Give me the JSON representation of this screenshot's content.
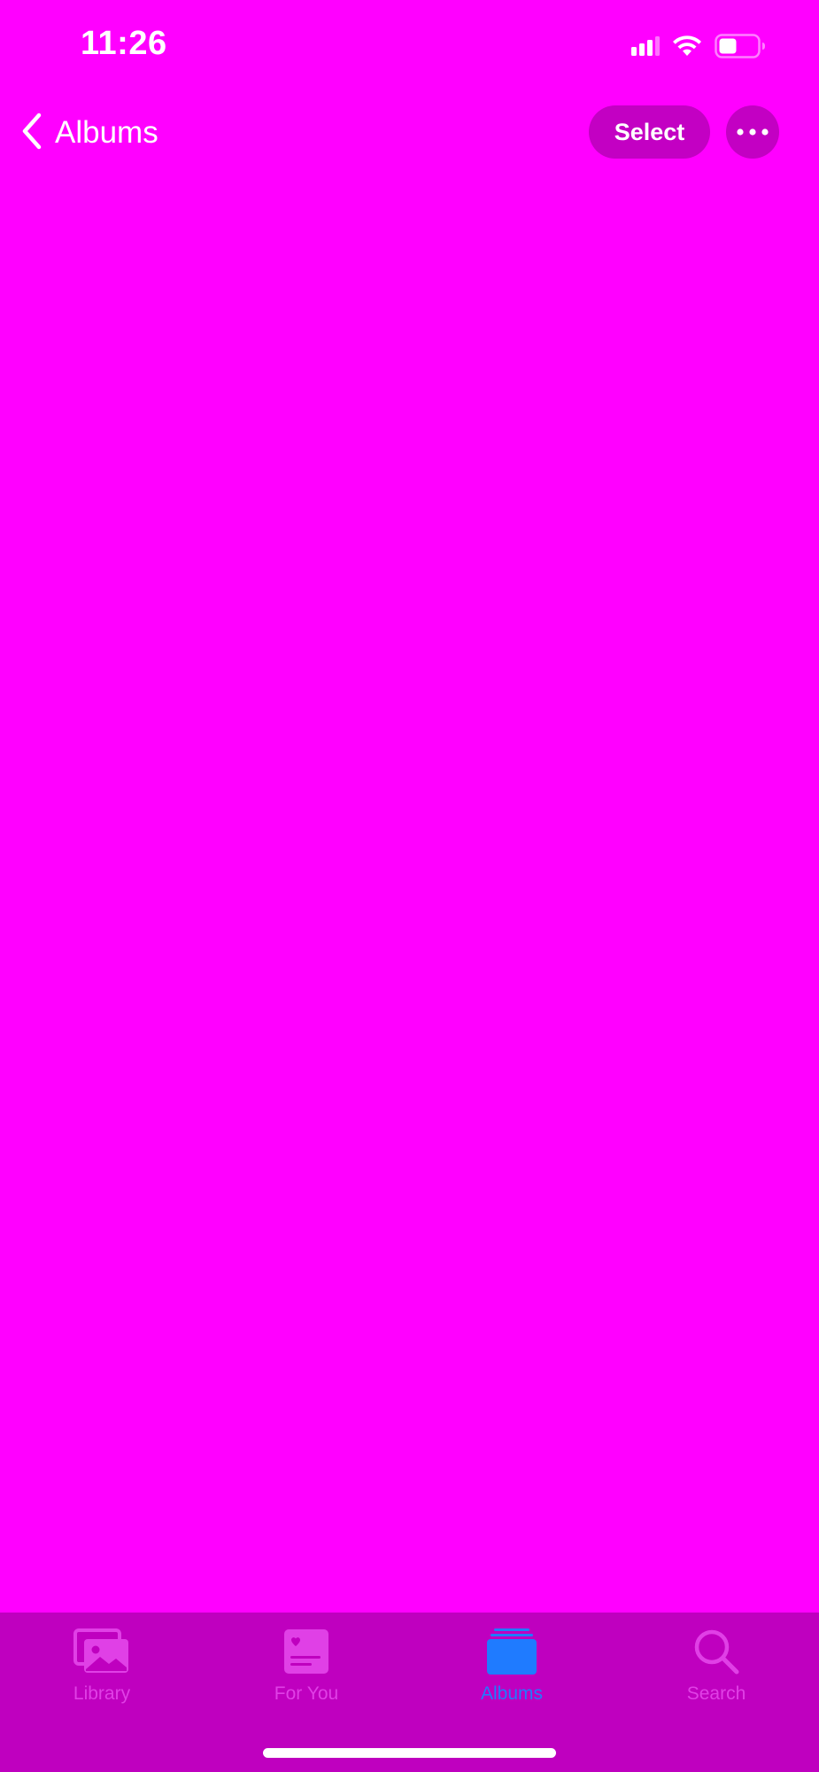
{
  "status_bar": {
    "time": "11:26"
  },
  "nav": {
    "back_label": "Albums",
    "select_label": "Select"
  },
  "tabs": [
    {
      "label": "Library",
      "icon": "photo-library-icon",
      "active": false
    },
    {
      "label": "For You",
      "icon": "for-you-icon",
      "active": false
    },
    {
      "label": "Albums",
      "icon": "albums-icon",
      "active": true
    },
    {
      "label": "Search",
      "icon": "search-icon",
      "active": false
    }
  ],
  "colors": {
    "background": "#ff00ff",
    "button_fill": "#c300c3",
    "tab_bar": "#bf00bf",
    "tab_inactive": "#e040e6",
    "tab_active": "#1f7bff",
    "text": "#ffffff"
  }
}
